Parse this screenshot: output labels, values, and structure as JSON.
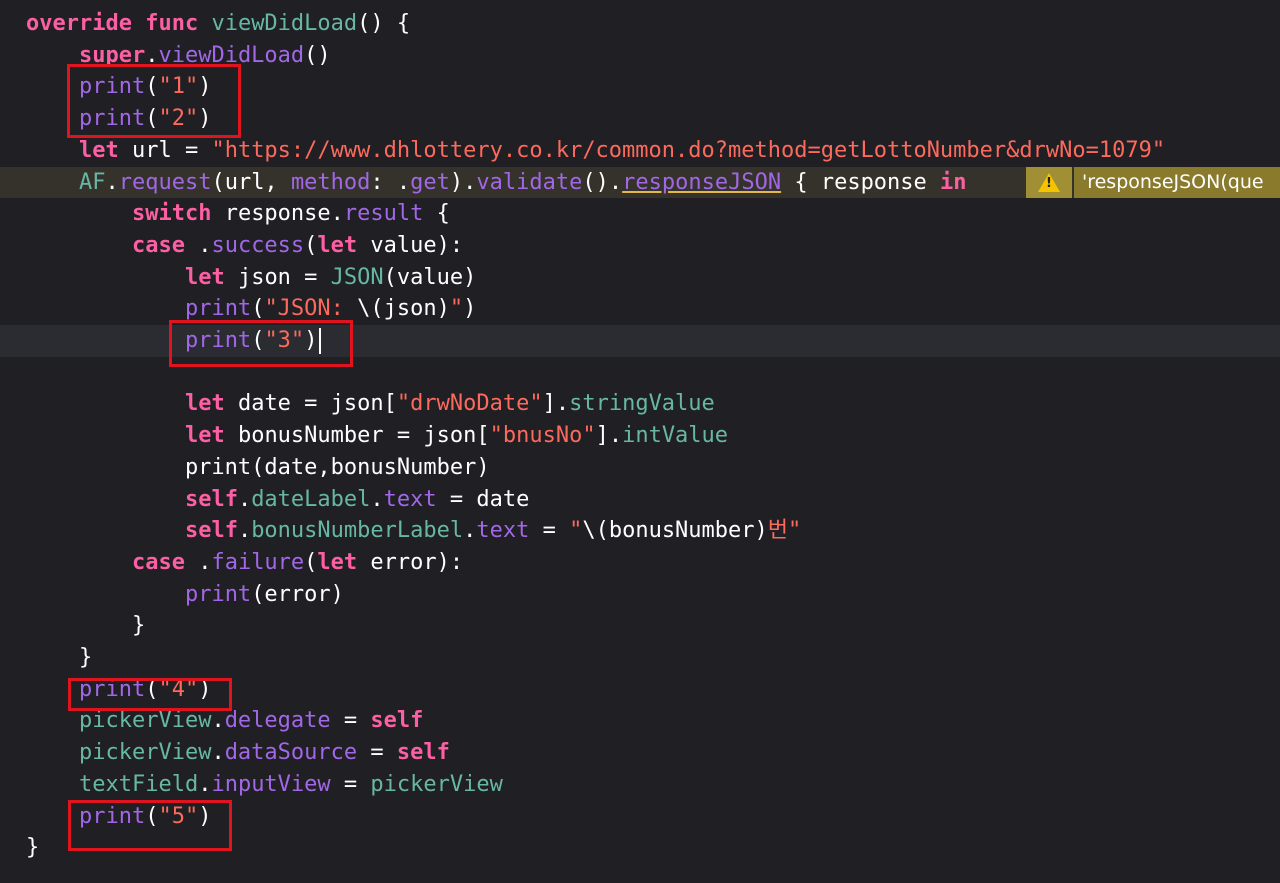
{
  "editor": {
    "lines": [
      [
        [
          "kw",
          "override"
        ],
        [
          "p",
          " "
        ],
        [
          "kw",
          "func"
        ],
        [
          "p",
          " "
        ],
        [
          "fn",
          "viewDidLoad"
        ],
        [
          "p",
          "() {"
        ]
      ],
      [
        [
          "p",
          "    "
        ],
        [
          "kw",
          "super"
        ],
        [
          "p",
          "."
        ],
        [
          "pr",
          "viewDidLoad"
        ],
        [
          "p",
          "()"
        ]
      ],
      [
        [
          "p",
          "    "
        ],
        [
          "pr",
          "print"
        ],
        [
          "p",
          "("
        ],
        [
          "str",
          "\"1\""
        ],
        [
          "p",
          ")"
        ]
      ],
      [
        [
          "p",
          "    "
        ],
        [
          "pr",
          "print"
        ],
        [
          "p",
          "("
        ],
        [
          "str",
          "\"2\""
        ],
        [
          "p",
          ")"
        ]
      ],
      [
        [
          "p",
          "    "
        ],
        [
          "kw",
          "let"
        ],
        [
          "p",
          " url = "
        ],
        [
          "str",
          "\"https://www.dhlottery.co.kr/common.do?method=getLottoNumber&drwNo=1079\""
        ]
      ],
      [
        [
          "p",
          "    "
        ],
        [
          "fn",
          "AF"
        ],
        [
          "p",
          "."
        ],
        [
          "pr",
          "request"
        ],
        [
          "p",
          "(url, "
        ],
        [
          "pr",
          "method"
        ],
        [
          "p",
          ": ."
        ],
        [
          "pr",
          "get"
        ],
        [
          "p",
          ")."
        ],
        [
          "pr",
          "validate"
        ],
        [
          "p",
          "()."
        ],
        [
          "prU",
          "responseJSON"
        ],
        [
          "p",
          " { response "
        ],
        [
          "kw",
          "in"
        ]
      ],
      [
        [
          "p",
          "        "
        ],
        [
          "kw",
          "switch"
        ],
        [
          "p",
          " response."
        ],
        [
          "pr",
          "result"
        ],
        [
          "p",
          " {"
        ]
      ],
      [
        [
          "p",
          "        "
        ],
        [
          "kw",
          "case"
        ],
        [
          "p",
          " ."
        ],
        [
          "pr",
          "success"
        ],
        [
          "p",
          "("
        ],
        [
          "kw",
          "let"
        ],
        [
          "p",
          " value):"
        ]
      ],
      [
        [
          "p",
          "            "
        ],
        [
          "kw",
          "let"
        ],
        [
          "p",
          " json = "
        ],
        [
          "fn",
          "JSON"
        ],
        [
          "p",
          "(value)"
        ]
      ],
      [
        [
          "p",
          "            "
        ],
        [
          "pr",
          "print"
        ],
        [
          "p",
          "("
        ],
        [
          "str",
          "\"JSON: "
        ],
        [
          "p",
          "\\(json)"
        ],
        [
          "str",
          "\""
        ],
        [
          "p",
          ")"
        ]
      ],
      [
        [
          "p",
          "            "
        ],
        [
          "pr",
          "print"
        ],
        [
          "p",
          "("
        ],
        [
          "str",
          "\"3\""
        ],
        [
          "p",
          ")"
        ]
      ],
      [
        [
          "p",
          ""
        ]
      ],
      [
        [
          "p",
          "            "
        ],
        [
          "kw",
          "let"
        ],
        [
          "p",
          " date = json["
        ],
        [
          "str",
          "\"drwNoDate\""
        ],
        [
          "p",
          "]."
        ],
        [
          "memb",
          "stringValue"
        ]
      ],
      [
        [
          "p",
          "            "
        ],
        [
          "kw",
          "let"
        ],
        [
          "p",
          " bonusNumber = json["
        ],
        [
          "str",
          "\"bnusNo\""
        ],
        [
          "p",
          "]."
        ],
        [
          "memb",
          "intValue"
        ]
      ],
      [
        [
          "p",
          "            print(date,bonusNumber)"
        ]
      ],
      [
        [
          "p",
          "            "
        ],
        [
          "kw",
          "self"
        ],
        [
          "p",
          "."
        ],
        [
          "memb",
          "dateLabel"
        ],
        [
          "p",
          "."
        ],
        [
          "pr",
          "text"
        ],
        [
          "p",
          " = date"
        ]
      ],
      [
        [
          "p",
          "            "
        ],
        [
          "kw",
          "self"
        ],
        [
          "p",
          "."
        ],
        [
          "memb",
          "bonusNumberLabel"
        ],
        [
          "p",
          "."
        ],
        [
          "pr",
          "text"
        ],
        [
          "p",
          " = "
        ],
        [
          "str",
          "\""
        ],
        [
          "p",
          "\\(bonusNumber)"
        ],
        [
          "str",
          "번\""
        ]
      ],
      [
        [
          "p",
          "        "
        ],
        [
          "kw",
          "case"
        ],
        [
          "p",
          " ."
        ],
        [
          "pr",
          "failure"
        ],
        [
          "p",
          "("
        ],
        [
          "kw",
          "let"
        ],
        [
          "p",
          " error):"
        ]
      ],
      [
        [
          "p",
          "            "
        ],
        [
          "pr",
          "print"
        ],
        [
          "p",
          "(error)"
        ]
      ],
      [
        [
          "p",
          "        }"
        ]
      ],
      [
        [
          "p",
          "    }"
        ]
      ],
      [
        [
          "p",
          "    "
        ],
        [
          "pr",
          "print"
        ],
        [
          "p",
          "("
        ],
        [
          "str",
          "\"4\""
        ],
        [
          "p",
          ")"
        ]
      ],
      [
        [
          "p",
          "    "
        ],
        [
          "memb",
          "pickerView"
        ],
        [
          "p",
          "."
        ],
        [
          "pr",
          "delegate"
        ],
        [
          "p",
          " = "
        ],
        [
          "kw",
          "self"
        ]
      ],
      [
        [
          "p",
          "    "
        ],
        [
          "memb",
          "pickerView"
        ],
        [
          "p",
          "."
        ],
        [
          "pr",
          "dataSource"
        ],
        [
          "p",
          " = "
        ],
        [
          "kw",
          "self"
        ]
      ],
      [
        [
          "p",
          "    "
        ],
        [
          "memb",
          "textField"
        ],
        [
          "p",
          "."
        ],
        [
          "pr",
          "inputView"
        ],
        [
          "p",
          " = "
        ],
        [
          "memb",
          "pickerView"
        ]
      ],
      [
        [
          "p",
          "    "
        ],
        [
          "pr",
          "print"
        ],
        [
          "p",
          "("
        ],
        [
          "str",
          "\"5\""
        ],
        [
          "p",
          ")"
        ]
      ],
      [
        [
          "p",
          "}"
        ]
      ]
    ],
    "warning_message": "'responseJSON(que"
  }
}
